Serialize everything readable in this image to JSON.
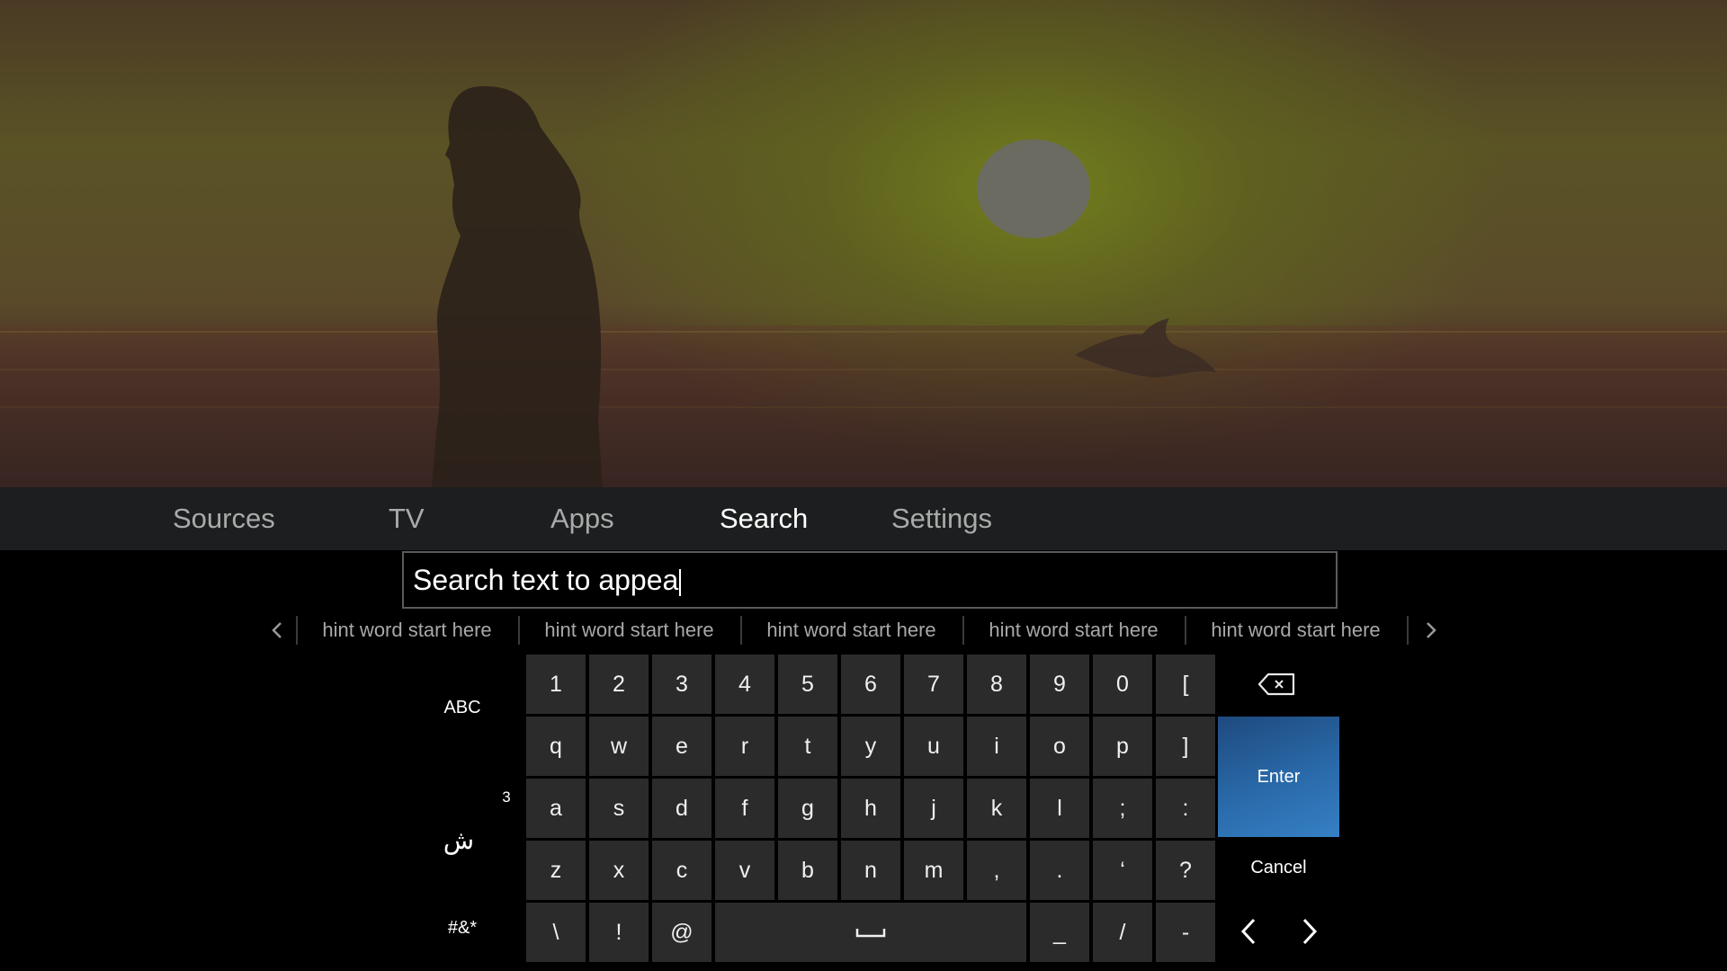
{
  "nav": {
    "items": [
      {
        "label": "Sources"
      },
      {
        "label": "TV"
      },
      {
        "label": "Apps"
      },
      {
        "label": "Search",
        "active": true
      },
      {
        "label": "Settings"
      }
    ]
  },
  "search": {
    "value": "Search text to appea"
  },
  "hints": [
    "hint word start here",
    "hint word start here",
    "hint word start here",
    "hint word start here",
    "hint word start here"
  ],
  "keyboard": {
    "modes": {
      "abc": "ABC",
      "arabic": "ش",
      "arabic_badge": "3",
      "symbols": "#&*"
    },
    "rows": [
      [
        "1",
        "2",
        "3",
        "4",
        "5",
        "6",
        "7",
        "8",
        "9",
        "0",
        "["
      ],
      [
        "q",
        "w",
        "e",
        "r",
        "t",
        "y",
        "u",
        "i",
        "o",
        "p",
        "]"
      ],
      [
        "a",
        "s",
        "d",
        "f",
        "g",
        "h",
        "j",
        "k",
        "l",
        ";",
        ":"
      ],
      [
        "z",
        "x",
        "c",
        "v",
        "b",
        "n",
        "m",
        ",",
        ".",
        "‘",
        "?"
      ],
      [
        "\\",
        "!",
        "@"
      ]
    ],
    "bottom_right_keys": [
      "_",
      "/",
      "-"
    ],
    "enter_label": "Enter",
    "cancel_label": "Cancel"
  },
  "colors": {
    "accent_enter": "#2a6aaa",
    "nav_bg": "#1c1e1f",
    "key_bg": "#2b2b2b"
  },
  "icons": {
    "backspace": "backspace-icon",
    "space": "space-bar-icon",
    "hint_prev": "chevron-left-icon",
    "hint_next": "chevron-right-icon",
    "cursor_left": "chevron-left-icon",
    "cursor_right": "chevron-right-icon"
  }
}
